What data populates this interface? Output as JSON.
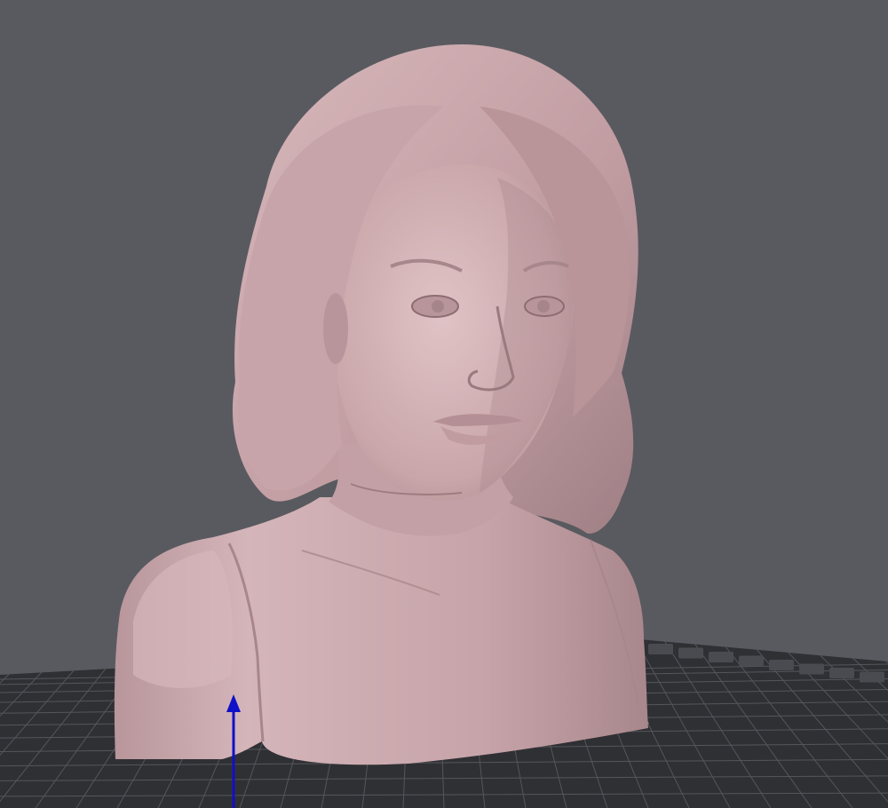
{
  "app": {
    "window_title": "",
    "view_mode": "3d-perspective"
  },
  "scene": {
    "background_color": "#595a5f",
    "build_plate": {
      "color": "#2f3034",
      "grid_line_color": "#55565b",
      "grid_visible": true
    },
    "model": {
      "description": "bust",
      "color": "#c9a6aa",
      "shadow_color": "#8d6d72",
      "highlight_color": "#e0c3c6"
    },
    "axis_gizmo": {
      "axis": "z",
      "color": "#1010c8"
    },
    "plate_edge_icons": {
      "count": 8,
      "color": "#4a4b50"
    }
  }
}
